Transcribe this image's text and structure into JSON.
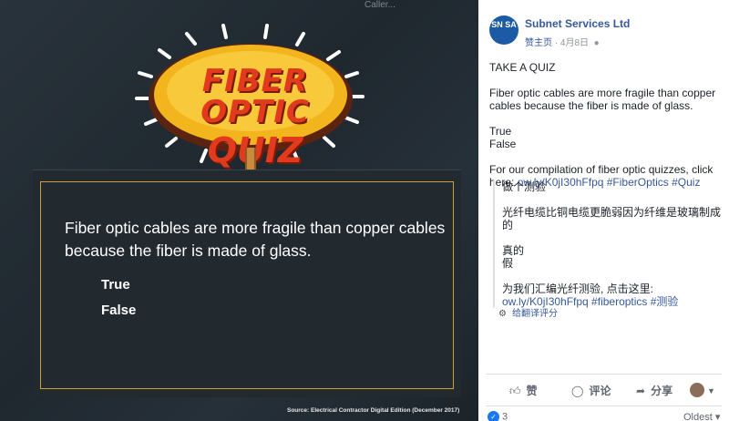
{
  "image": {
    "header_fragment": "Caller...",
    "logo_line1": "FIBER OPTIC",
    "logo_line2": "QUIZ",
    "question": "Fiber optic cables are more fragile than copper cables because the fiber is made of glass.",
    "option_true": "True",
    "option_false": "False",
    "source": "Source: Electrical Contractor Digital Edition (December 2017)"
  },
  "post": {
    "avatar_text": "SN SA",
    "page_name": "Subnet Services Ltd",
    "like_page": "赞主页",
    "date": "4月8日",
    "body": {
      "heading": "TAKE A QUIZ",
      "question": "Fiber optic cables are more fragile than copper cables because the fiber is made of glass.",
      "opt_true": "True",
      "opt_false": "False",
      "compilation": "For our compilation of fiber optic quizzes, click here:",
      "link": "ow.ly/K0jI30hFfpq #FiberOptics #Quiz"
    },
    "translation": {
      "heading": "做个测验",
      "question": "光纤电缆比铜电缆更脆弱因为纤维是玻璃制成的",
      "opt_true": "真的",
      "opt_false": "假",
      "compilation": "为我们汇编光纤测验, 点击这里:",
      "link": "ow.ly/K0jI30hFfpq #fiberoptics #测验",
      "rate": "给翻译评分"
    },
    "actions": {
      "like": "赞",
      "comment": "评论",
      "share": "分享"
    },
    "reactions_count": "3",
    "sort_label": "Oldest"
  },
  "icons": {
    "like": "thumbs-up-icon",
    "comment": "comment-bubble-icon",
    "share": "share-arrow-icon",
    "gear": "gear-icon"
  },
  "colors": {
    "link": "#365899",
    "board_border": "#c9a23a",
    "logo_red": "#e23a1c",
    "logo_orange": "#f39a1e"
  }
}
